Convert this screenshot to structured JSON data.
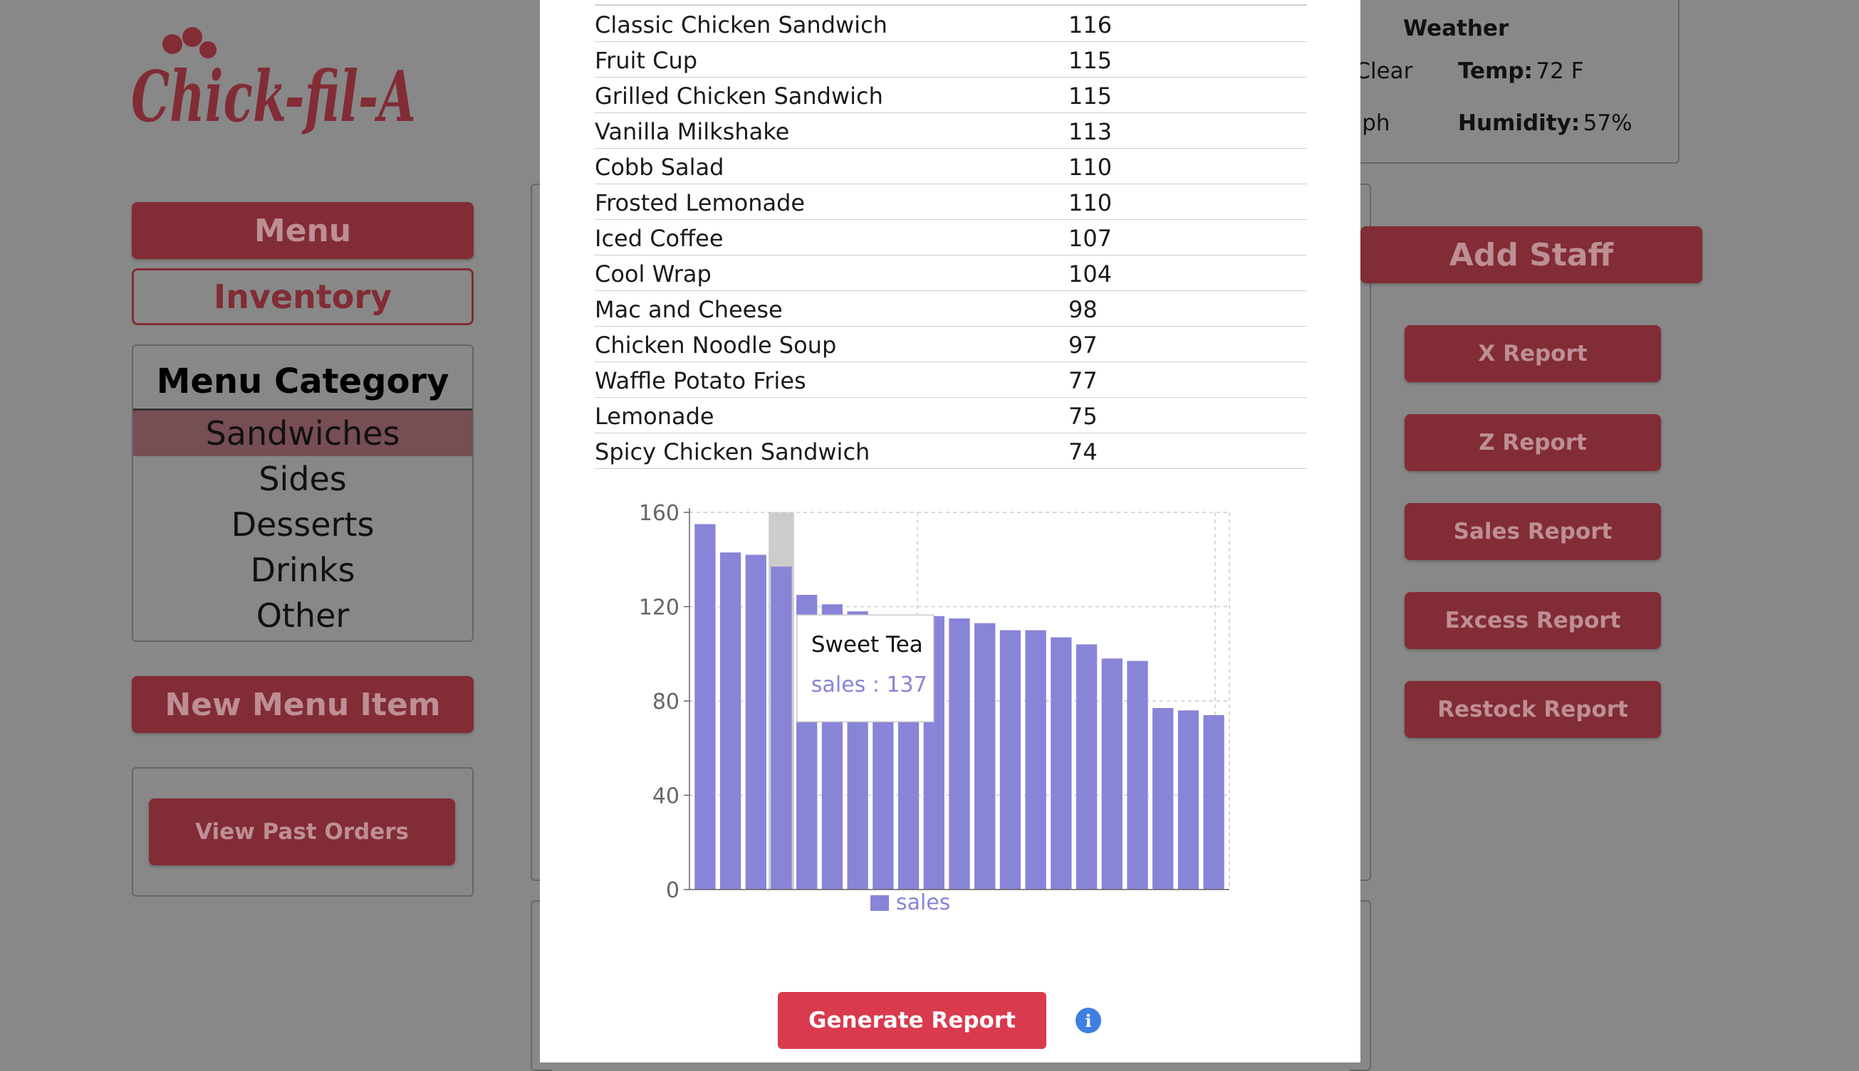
{
  "logo": {
    "text": "Chick-fil-A"
  },
  "left": {
    "menu_label": "Menu",
    "inventory_label": "Inventory",
    "category_title": "Menu Category",
    "categories": [
      "Sandwiches",
      "Sides",
      "Desserts",
      "Drinks",
      "Other"
    ],
    "new_item_label": "New Menu Item",
    "view_orders_label": "View Past Orders"
  },
  "weather": {
    "title": "Weather",
    "cond_partial": ": Clear",
    "temp_label": "Temp:",
    "temp_value": "72 F",
    "wind_partial": "mph",
    "humidity_label": "Humidity:",
    "humidity_value": "57%"
  },
  "right": {
    "add_staff_label": "Add Staff",
    "x_report": "X Report",
    "z_report": "Z Report",
    "sales_report": "Sales Report",
    "excess_report": "Excess Report",
    "restock_report": "Restock Report"
  },
  "table": {
    "rows": [
      {
        "name": "Classic Chicken Sandwich",
        "value": "116"
      },
      {
        "name": "Fruit Cup",
        "value": "115"
      },
      {
        "name": "Grilled Chicken Sandwich",
        "value": "115"
      },
      {
        "name": "Vanilla Milkshake",
        "value": "113"
      },
      {
        "name": "Cobb Salad",
        "value": "110"
      },
      {
        "name": "Frosted Lemonade",
        "value": "110"
      },
      {
        "name": "Iced Coffee",
        "value": "107"
      },
      {
        "name": "Cool Wrap",
        "value": "104"
      },
      {
        "name": "Mac and Cheese",
        "value": "98"
      },
      {
        "name": "Chicken Noodle Soup",
        "value": "97"
      },
      {
        "name": "Waffle Potato Fries",
        "value": "77"
      },
      {
        "name": "Lemonade",
        "value": "75"
      },
      {
        "name": "Spicy Chicken Sandwich",
        "value": "74"
      }
    ]
  },
  "chart_data": {
    "type": "bar",
    "series": [
      {
        "name": "sales",
        "values": [
          155,
          143,
          142,
          137,
          125,
          121,
          118,
          116,
          116,
          116,
          115,
          113,
          110,
          110,
          107,
          104,
          98,
          97,
          77,
          76,
          74
        ]
      }
    ],
    "ylim": [
      0,
      160
    ],
    "yticks": [
      "0",
      "40",
      "80",
      "120",
      "160"
    ],
    "legend": "sales",
    "legend_position": "bottom",
    "grid": true,
    "highlight_index": 3,
    "tooltip": {
      "title": "Sweet Tea",
      "text": "sales : 137"
    },
    "bar_color": "#8884d8"
  },
  "generate_label": "Generate Report",
  "info_glyph": "i"
}
